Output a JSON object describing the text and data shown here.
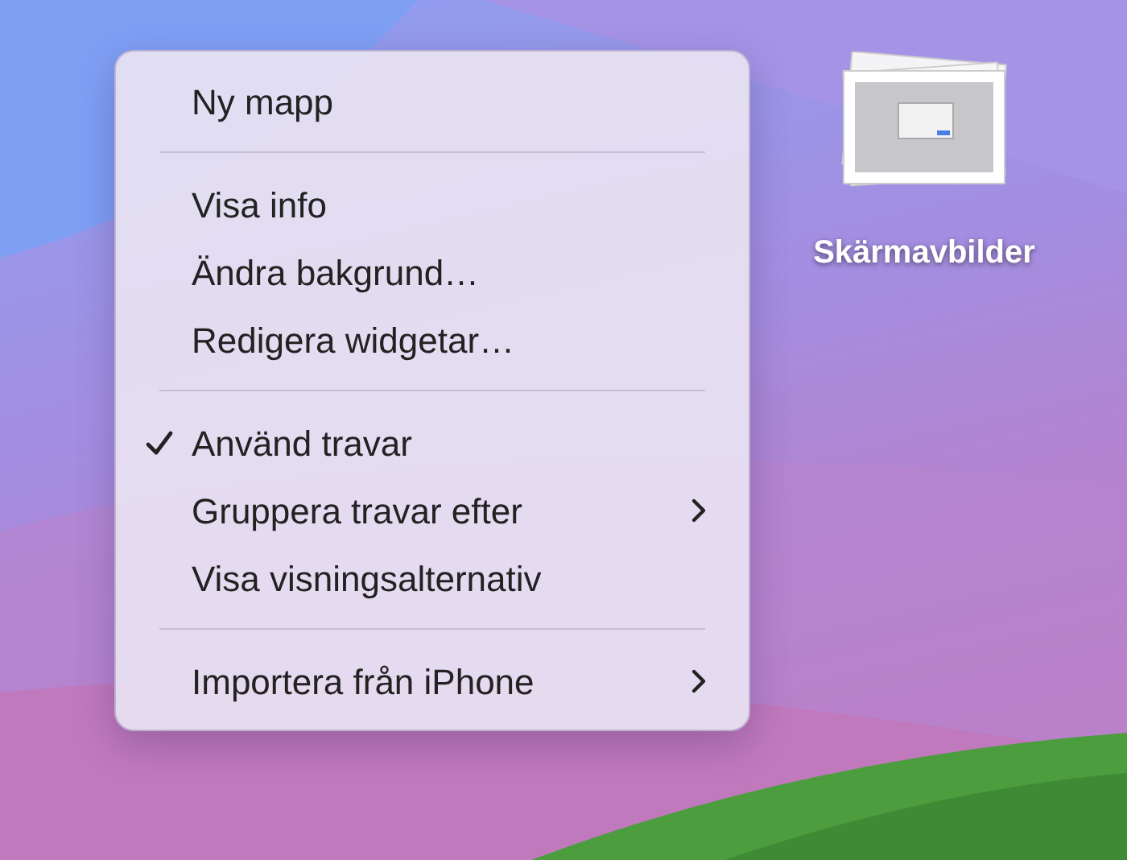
{
  "menu": {
    "sections": [
      {
        "items": [
          {
            "label": "Ny mapp",
            "checked": false,
            "submenu": false
          }
        ]
      },
      {
        "items": [
          {
            "label": "Visa info",
            "checked": false,
            "submenu": false
          },
          {
            "label": "Ändra bakgrund…",
            "checked": false,
            "submenu": false
          },
          {
            "label": "Redigera widgetar…",
            "checked": false,
            "submenu": false
          }
        ]
      },
      {
        "items": [
          {
            "label": "Använd travar",
            "checked": true,
            "submenu": false
          },
          {
            "label": "Gruppera travar efter",
            "checked": false,
            "submenu": true
          },
          {
            "label": "Visa visningsalternativ",
            "checked": false,
            "submenu": false
          }
        ]
      },
      {
        "items": [
          {
            "label": "Importera från iPhone",
            "checked": false,
            "submenu": true
          }
        ]
      }
    ]
  },
  "desktop_icon": {
    "label": "Skärmavbilder"
  }
}
